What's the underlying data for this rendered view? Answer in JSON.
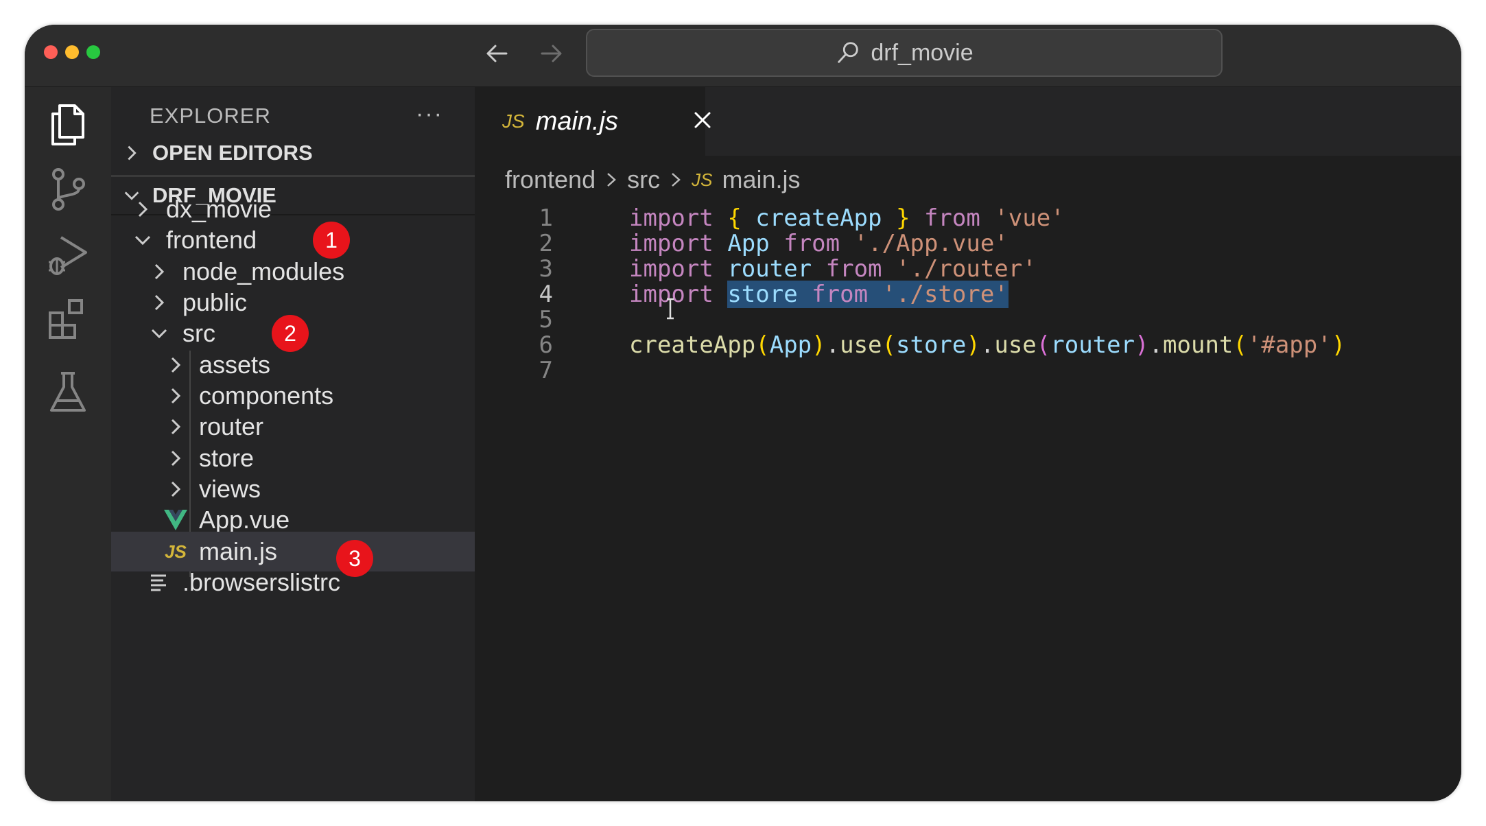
{
  "window": {
    "traffic_lights": {
      "red": "#fe5f57",
      "yellow": "#febc2e",
      "green": "#28c840"
    },
    "command_center": "drf_movie"
  },
  "activity_bar": {
    "icons": [
      "explorer-icon",
      "source-control-icon",
      "run-debug-icon",
      "extensions-icon",
      "testing-icon"
    ]
  },
  "sidebar": {
    "title": "EXPLORER",
    "more": "···",
    "open_editors": "OPEN EDITORS",
    "workspace": "DRF_MOVIE",
    "tree": [
      {
        "label": "dx_movie",
        "kind": "folder",
        "expanded": false
      },
      {
        "label": "frontend",
        "kind": "folder",
        "expanded": true,
        "badge": "1"
      },
      {
        "label": "node_modules",
        "kind": "folder",
        "expanded": false
      },
      {
        "label": "public",
        "kind": "folder",
        "expanded": false
      },
      {
        "label": "src",
        "kind": "folder",
        "expanded": true,
        "badge": "2"
      },
      {
        "label": "assets",
        "kind": "folder",
        "expanded": false
      },
      {
        "label": "components",
        "kind": "folder",
        "expanded": false
      },
      {
        "label": "router",
        "kind": "folder",
        "expanded": false
      },
      {
        "label": "store",
        "kind": "folder",
        "expanded": false
      },
      {
        "label": "views",
        "kind": "folder",
        "expanded": false
      },
      {
        "label": "App.vue",
        "kind": "vue"
      },
      {
        "label": "main.js",
        "kind": "js",
        "selected": true,
        "badge": "3"
      },
      {
        "label": ".browserslistrc",
        "kind": "text"
      }
    ]
  },
  "editor": {
    "tab": {
      "badge": "JS",
      "title": "main.js"
    },
    "breadcrumb": {
      "p1": "frontend",
      "p2": "src",
      "badge": "JS",
      "p3": "main.js"
    },
    "active_line": 4,
    "lines": [
      {
        "n": "1",
        "t": {
          "a": "import",
          "b": " ",
          "c": "{",
          "d": " createApp ",
          "e": "}",
          "f": " ",
          "g": "from",
          "h": " ",
          "i": "'vue'"
        }
      },
      {
        "n": "2",
        "t": {
          "a": "import",
          "b": " ",
          "c": "App",
          "d": " ",
          "e": "from",
          "f": " ",
          "g": "'./App.vue'"
        }
      },
      {
        "n": "3",
        "t": {
          "a": "import",
          "b": " ",
          "c": "router",
          "d": " ",
          "e": "from",
          "f": " ",
          "g": "'./router'"
        }
      },
      {
        "n": "4",
        "t": {
          "a": "import",
          "b": " ",
          "c": "store",
          "d": " ",
          "e": "from",
          "f": " ",
          "g": "'./store'"
        }
      },
      {
        "n": "5",
        "t": {}
      },
      {
        "n": "6",
        "t": {
          "a": "createApp",
          "b": "(",
          "c": "App",
          "d": ")",
          "e": ".",
          "f": "use",
          "g": "(",
          "h": "store",
          "i": ")",
          "j": ".",
          "k": "use",
          "l": "(",
          "m": "router",
          "o": ")",
          "p": ".",
          "q": "mount",
          "r": "(",
          "s": "'#app'",
          "u": ")"
        }
      },
      {
        "n": "7",
        "t": {}
      }
    ]
  },
  "colors": {
    "keyword": "#c586c0",
    "identifier": "#9cdcfe",
    "string": "#ce9178",
    "function": "#dcdcaa",
    "selection": "#264f78",
    "badge": "#e8141b"
  }
}
